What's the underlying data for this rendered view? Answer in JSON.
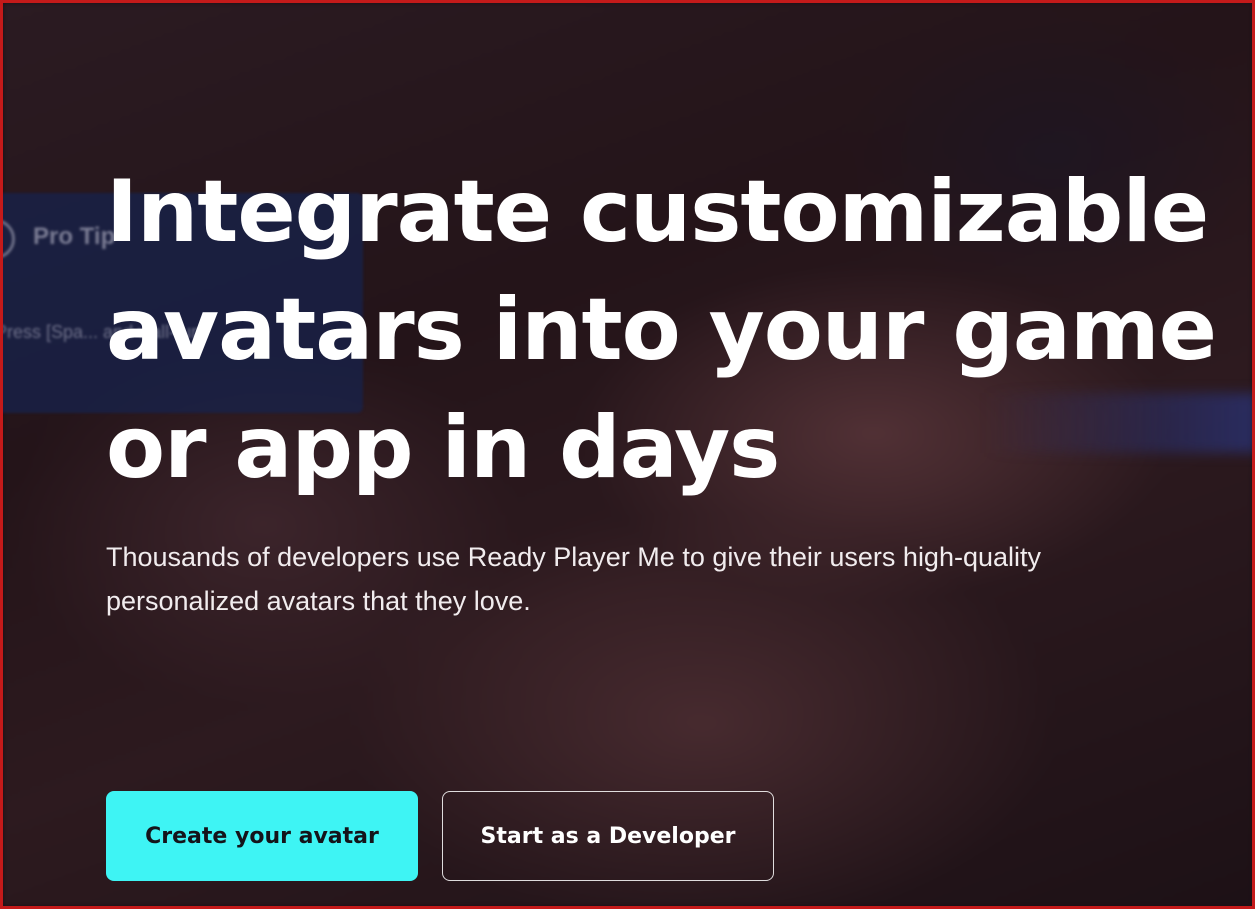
{
  "overlay": {
    "protip_title": "Pro Tip",
    "protip_icon": "exclamation-icon",
    "protip_text": "Press [Spa... and wall-run"
  },
  "hero": {
    "headline": "Integrate customizable avatars into your game or app in days",
    "subtitle": "Thousands of developers use Ready Player Me to give their users high-quality personalized avatars that they love."
  },
  "actions": {
    "primary_label": "Create your avatar",
    "secondary_label": "Start as a Developer"
  },
  "colors": {
    "accent": "#3ef4f4",
    "border": "#c41a1a",
    "background": "#241419"
  }
}
